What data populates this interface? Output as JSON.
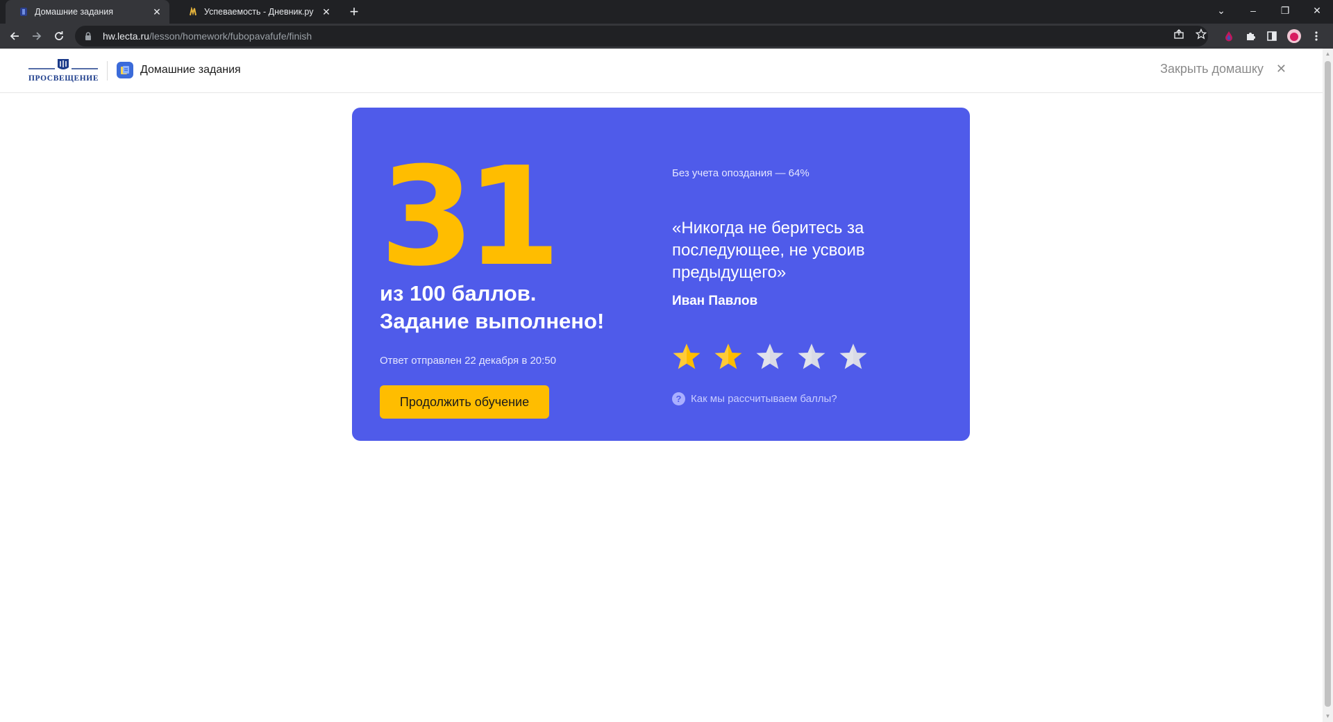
{
  "browser": {
    "tabs": [
      {
        "title": "Домашние задания",
        "active": true
      },
      {
        "title": "Успеваемость - Дневник.ру",
        "active": false
      }
    ],
    "url_host": "hw.lecta.ru",
    "url_path": "/lesson/homework/fubopavafufe/finish"
  },
  "header": {
    "logo_text": "ПРОСВЕЩЕНИЕ",
    "app_title": "Домашние задания",
    "close_label": "Закрыть домашку"
  },
  "result": {
    "score": "31",
    "score_line1": "из 100 баллов.",
    "score_line2": "Задание выполнено!",
    "sent_text": "Ответ отправлен 22 декабря в 20:50",
    "continue_label": "Продолжить обучение",
    "late_text": "Без учета опоздания — 64%",
    "quote": "«Никогда не беритесь за последующее, не усвоив предыдущего»",
    "author": "Иван Павлов",
    "rating": 2,
    "rating_max": 5,
    "how_calc_label": "Как мы рассчитываем баллы?"
  },
  "colors": {
    "card": "#4f5bea",
    "accent": "#ffbd00",
    "star_empty": "#d9dbe6"
  }
}
